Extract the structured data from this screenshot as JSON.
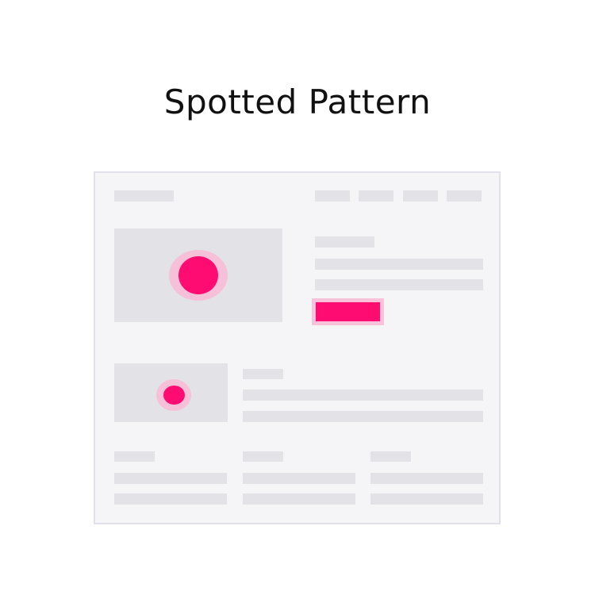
{
  "title": "Spotted Pattern",
  "colors": {
    "accent": "#ff0c72",
    "accent_halo": "#f6c0d8",
    "placeholder": "#e3e2e6",
    "frame_bg": "#f5f4f7",
    "frame_border": "#e2e0e8"
  },
  "wireframe": {
    "nav_item_count": 4,
    "hotspots": [
      "hero-image-hotspot",
      "secondary-image-hotspot"
    ],
    "cta_highlighted": true
  }
}
